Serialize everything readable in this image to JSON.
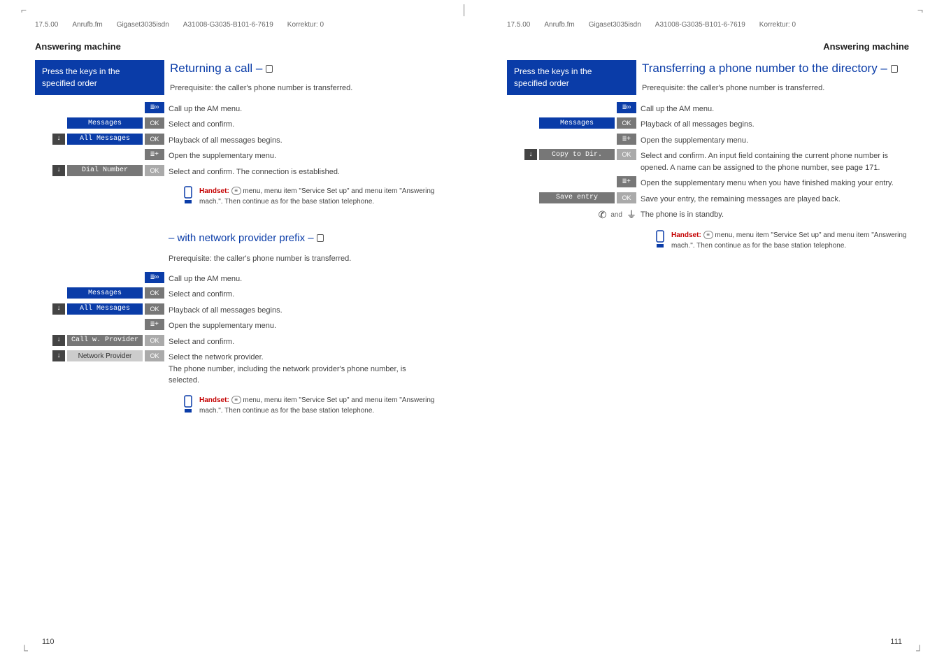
{
  "header": {
    "date": "17.5.00",
    "file": "Anrufb.fm",
    "device": "Gigaset3035isdn",
    "docno": "A31008-G3035-B101-6-7619",
    "korr": "Korrektur: 0"
  },
  "section_title": "Answering machine",
  "blue_box": {
    "line1": "Press the keys in the",
    "line2": "specified order"
  },
  "left_page": {
    "heading1": "Returning a call – ",
    "prereq": "Prerequisite: the caller's phone number is transferred.",
    "steps1": {
      "s1": "Call up the AM menu.",
      "s2": "Select and confirm.",
      "s3": "Playback of all messages begins.",
      "s4": "Open the supplementary menu.",
      "s5": "Select and confirm. The connection is established."
    },
    "labels": {
      "messages": "Messages",
      "all_messages": "All Messages",
      "dial_number": "Dial Number",
      "ok": "OK",
      "call_w_provider": "Call w. Provider",
      "network_provider": "Network Provider"
    },
    "heading2": "– with network provider prefix – ",
    "steps2": {
      "s1": "Call up the AM menu.",
      "s2": "Select and confirm.",
      "s3": "Playback of all messages begins.",
      "s4": "Open the supplementary menu.",
      "s5": "Select and confirm.",
      "s6": "Select the network provider.\nThe phone number, including the network provider's phone number, is selected."
    },
    "note": {
      "label": "Handset:",
      "text": " menu, menu item \"Service Set up\" and menu item \"Answering mach.\". Then continue as for the base station telephone."
    },
    "page_no": "110"
  },
  "right_page": {
    "heading1": "Transferring a phone number to the directory – ",
    "prereq": "Prerequisite: the caller's phone number is transferred.",
    "steps1": {
      "s1": "Call up the AM menu.",
      "s2": "Playback of all messages begins.",
      "s3": "Open the supplementary menu.",
      "s4": "Select and confirm. An input field containing the current phone number is opened. A name can be assigned to the phone number, see page 171.",
      "s5": "Open the supplementary menu when you have finished making your entry.",
      "s6": "Save your entry, the remaining messages are played back.",
      "s7": "The phone is in standby."
    },
    "labels": {
      "messages": "Messages",
      "copy_to_dir": "Copy to Dir.",
      "save_entry": "Save entry",
      "ok": "OK",
      "and": "and"
    },
    "note": {
      "label": "Handset:",
      "text": " menu, menu item \"Service Set up\" and menu item \"Answering mach.\". Then continue as for the base station telephone."
    },
    "page_no": "111"
  }
}
